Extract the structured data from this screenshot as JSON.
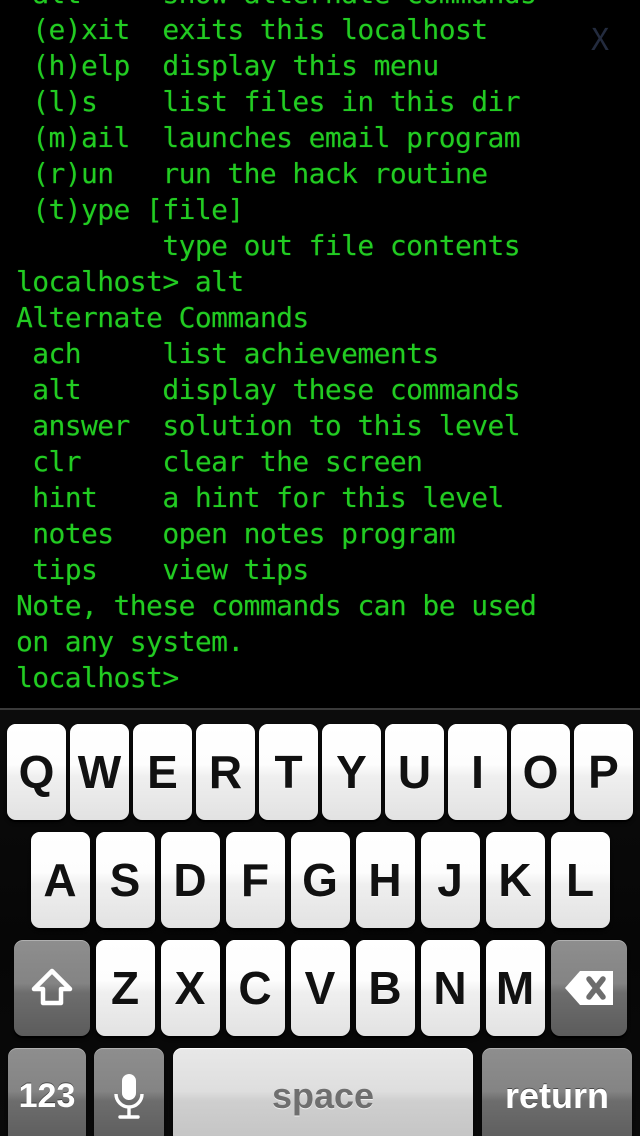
{
  "terminal": {
    "prompt_name": "localhost>",
    "text_color": "#22cc22",
    "background_color": "#000000",
    "close_button": "X",
    "close_button_color": "#232b3e",
    "lines": [
      " alt     show alternate commands",
      " (e)xit  exits this localhost",
      " (h)elp  display this menu",
      " (l)s    list files in this dir",
      " (m)ail  launches email program",
      " (r)un   run the hack routine",
      " (t)ype [file]",
      "         type out file contents",
      "localhost> alt",
      "Alternate Commands",
      " ach     list achievements",
      " alt     display these commands",
      " answer  solution to this level",
      " clr     clear the screen",
      " hint    a hint for this level",
      " notes   open notes program",
      " tips    view tips",
      "Note, these commands can be used",
      "on any system.",
      "localhost>"
    ]
  },
  "keyboard": {
    "layout": "qwerty-uppercase",
    "row1": [
      "Q",
      "W",
      "E",
      "R",
      "T",
      "Y",
      "U",
      "I",
      "O",
      "P"
    ],
    "row2": [
      "A",
      "S",
      "D",
      "F",
      "G",
      "H",
      "J",
      "K",
      "L"
    ],
    "row3": [
      "Z",
      "X",
      "C",
      "V",
      "B",
      "N",
      "M"
    ],
    "shift_icon": "shift-arrow-icon",
    "backspace_icon": "backspace-delete-icon",
    "numeric_label": "123",
    "mic_icon": "microphone-icon",
    "space_label": "space",
    "return_label": "return",
    "key_light_color": "#f4f4f4",
    "key_dark_color": "#7a7a7a",
    "space_color": "#d6d6d6",
    "background_color": "#0a0a0a"
  }
}
